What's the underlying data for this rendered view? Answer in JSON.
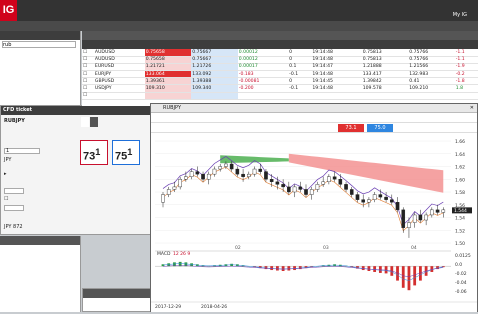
{
  "logo": "IG",
  "top": {
    "account": "",
    "menu1": "",
    "menu2": "",
    "help": "",
    "logout": "",
    "myig": "My IG",
    "mypage": ""
  },
  "top2": [
    {
      "l": "",
      "red": true
    },
    {
      "l": "",
      "red": false
    },
    {
      "l": "",
      "red": false
    },
    {
      "l": "",
      "red": false
    },
    {
      "l": "",
      "red": false
    }
  ],
  "nav": [
    "",
    "",
    "",
    "",
    "",
    "",
    "",
    "",
    "",
    "",
    "",
    "",
    "",
    "",
    ""
  ],
  "left": {
    "title": "",
    "search": "rub",
    "items": [
      "",
      "",
      "",
      "",
      "",
      "",
      ""
    ]
  },
  "ticket": {
    "title": "CFD ticket",
    "instrument": "RUBJPY",
    "tab1": "",
    "tab2": "",
    "sell_label": "",
    "sell_price": "73",
    "sell_sup": "1",
    "buy_label": "",
    "buy_price": "75",
    "buy_sup": "1",
    "qty_label": "",
    "qty_value": "1",
    "currency_label": "",
    "currency": "JPY",
    "advanced": "",
    "ccy_row": "",
    "stop_label": "",
    "stop_sub": "",
    "limit_label": "",
    "limit_sub": "",
    "margin_label": "",
    "margin_value": "JPY 872"
  },
  "bottomleft": {
    "title": "",
    "items": [
      "",
      "",
      "",
      ""
    ]
  },
  "bl2": {
    "title": ""
  },
  "tabbar": [
    "",
    "",
    "",
    "",
    ""
  ],
  "table": {
    "headers": [
      "",
      "",
      "",
      "",
      "",
      "",
      "",
      "",
      "",
      "",
      ""
    ],
    "rows": [
      {
        "name": "AUDUSD",
        "mark": "",
        "sell": "0.75658",
        "buy": "0.75667",
        "chg": "0.00012",
        "pct": "0",
        "time": "19:14:48",
        "hi": "0.75813",
        "lo": "0.75766",
        "lchg": "-1.1",
        "hs": true
      },
      {
        "name": "AUDUSD",
        "mark": "",
        "sell": "0.75658",
        "buy": "0.75667",
        "chg": "0.00012",
        "pct": "0",
        "time": "19:14:48",
        "hi": "0.75813",
        "lo": "0.75766",
        "lchg": "-1.1",
        "hs": false
      },
      {
        "name": "EURUSD",
        "mark": "",
        "sell": "1.21721",
        "buy": "1.21726",
        "chg": "0.00017",
        "pct": "0.1",
        "time": "19:14:47",
        "hi": "1.21888",
        "lo": "1.21566",
        "lchg": "-1.9",
        "hs": false
      },
      {
        "name": "EURJPY",
        "mark": "",
        "sell": "133.064",
        "buy": "133.092",
        "chg": "-0.183",
        "pct": "-0.1",
        "time": "19:14:48",
        "hi": "133.417",
        "lo": "132.983",
        "lchg": "-0.2",
        "hs": true
      },
      {
        "name": "GBPUSD",
        "mark": "",
        "sell": "1.39361",
        "buy": "1.39388",
        "chg": "-0.00081",
        "pct": "0",
        "time": "19:14:45",
        "hi": "1.39842",
        "lo": "0.41",
        "lchg": "-1.8",
        "hs": false
      },
      {
        "name": "USDJPY",
        "mark": "",
        "sell": "109.310",
        "buy": "109.340",
        "chg": "-0.200",
        "pct": "-0.1",
        "time": "19:14:48",
        "hi": "109.578",
        "lo": "109.210",
        "lchg": "1.8",
        "hs": false
      },
      {
        "name": "",
        "mark": "",
        "sell": "",
        "buy": "",
        "chg": "",
        "pct": "",
        "time": "",
        "hi": "",
        "lo": "",
        "lchg": "",
        "hs": false
      }
    ]
  },
  "chart": {
    "title": "RUBJPY",
    "toolbar": [
      "",
      "",
      "",
      "",
      "",
      "",
      ""
    ],
    "toolbar2": [
      "",
      "",
      "",
      ""
    ],
    "sell_btn": "73.1",
    "buy_btn": "75.0",
    "legend": "",
    "annotation": "",
    "macd_label": "MACD",
    "macd_params": "12 26 9",
    "date1": "2017-12-29",
    "date2": "2018-04-26",
    "status": "",
    "price_labels": [
      "1.66",
      "1.64",
      "1.62",
      "1.60",
      "1.58",
      "1.56",
      "1.54",
      "1.52",
      "1.50"
    ],
    "price_tag": "1.544",
    "macd_axis": [
      "0.0125",
      "0.0",
      "-0.02",
      "-0.04",
      "-0.06"
    ],
    "months": [
      "02",
      "03",
      "04"
    ]
  },
  "chart_data": {
    "type": "candlestick",
    "y_range": [
      1.48,
      1.68
    ],
    "candles": [
      [
        1.56,
        1.58,
        1.55,
        1.575
      ],
      [
        1.575,
        1.59,
        1.57,
        1.585
      ],
      [
        1.585,
        1.6,
        1.58,
        1.59
      ],
      [
        1.59,
        1.61,
        1.585,
        1.605
      ],
      [
        1.605,
        1.62,
        1.6,
        1.61
      ],
      [
        1.61,
        1.625,
        1.605,
        1.62
      ],
      [
        1.62,
        1.63,
        1.61,
        1.615
      ],
      [
        1.615,
        1.62,
        1.6,
        1.605
      ],
      [
        1.605,
        1.62,
        1.595,
        1.615
      ],
      [
        1.615,
        1.63,
        1.61,
        1.625
      ],
      [
        1.625,
        1.635,
        1.62,
        1.63
      ],
      [
        1.63,
        1.64,
        1.625,
        1.635
      ],
      [
        1.635,
        1.64,
        1.62,
        1.625
      ],
      [
        1.625,
        1.63,
        1.61,
        1.615
      ],
      [
        1.615,
        1.625,
        1.6,
        1.61
      ],
      [
        1.61,
        1.62,
        1.605,
        1.615
      ],
      [
        1.615,
        1.63,
        1.61,
        1.625
      ],
      [
        1.625,
        1.635,
        1.615,
        1.62
      ],
      [
        1.62,
        1.625,
        1.6,
        1.605
      ],
      [
        1.605,
        1.615,
        1.59,
        1.6
      ],
      [
        1.6,
        1.61,
        1.585,
        1.595
      ],
      [
        1.595,
        1.605,
        1.58,
        1.59
      ],
      [
        1.59,
        1.6,
        1.575,
        1.58
      ],
      [
        1.58,
        1.595,
        1.57,
        1.59
      ],
      [
        1.59,
        1.6,
        1.58,
        1.585
      ],
      [
        1.585,
        1.595,
        1.57,
        1.575
      ],
      [
        1.575,
        1.59,
        1.565,
        1.585
      ],
      [
        1.585,
        1.6,
        1.58,
        1.595
      ],
      [
        1.595,
        1.61,
        1.59,
        1.6
      ],
      [
        1.6,
        1.615,
        1.595,
        1.61
      ],
      [
        1.61,
        1.62,
        1.6,
        1.605
      ],
      [
        1.605,
        1.615,
        1.59,
        1.595
      ],
      [
        1.595,
        1.6,
        1.58,
        1.585
      ],
      [
        1.585,
        1.59,
        1.57,
        1.575
      ],
      [
        1.575,
        1.58,
        1.56,
        1.565
      ],
      [
        1.565,
        1.575,
        1.55,
        1.56
      ],
      [
        1.56,
        1.57,
        1.55,
        1.565
      ],
      [
        1.565,
        1.58,
        1.56,
        1.575
      ],
      [
        1.575,
        1.585,
        1.565,
        1.57
      ],
      [
        1.57,
        1.58,
        1.56,
        1.565
      ],
      [
        1.565,
        1.575,
        1.555,
        1.56
      ],
      [
        1.56,
        1.57,
        1.54,
        1.545
      ],
      [
        1.545,
        1.55,
        1.5,
        1.51
      ],
      [
        1.51,
        1.53,
        1.49,
        1.52
      ],
      [
        1.52,
        1.54,
        1.51,
        1.535
      ],
      [
        1.535,
        1.545,
        1.52,
        1.525
      ],
      [
        1.525,
        1.54,
        1.515,
        1.535
      ],
      [
        1.535,
        1.55,
        1.53,
        1.545
      ],
      [
        1.545,
        1.555,
        1.535,
        1.54
      ],
      [
        1.54,
        1.55,
        1.53,
        1.545
      ]
    ],
    "macd_hist": [
      0.004,
      0.006,
      0.008,
      0.009,
      0.008,
      0.006,
      0.004,
      0.002,
      0.001,
      0.002,
      0.003,
      0.004,
      0.005,
      0.004,
      0.002,
      0.0,
      -0.002,
      -0.004,
      -0.006,
      -0.008,
      -0.009,
      -0.01,
      -0.009,
      -0.008,
      -0.006,
      -0.004,
      -0.002,
      0.0,
      0.002,
      0.003,
      0.004,
      0.003,
      0.001,
      -0.002,
      -0.005,
      -0.008,
      -0.01,
      -0.012,
      -0.014,
      -0.015,
      -0.02,
      -0.03,
      -0.045,
      -0.05,
      -0.04,
      -0.03,
      -0.02,
      -0.012,
      -0.006,
      -0.002
    ]
  }
}
